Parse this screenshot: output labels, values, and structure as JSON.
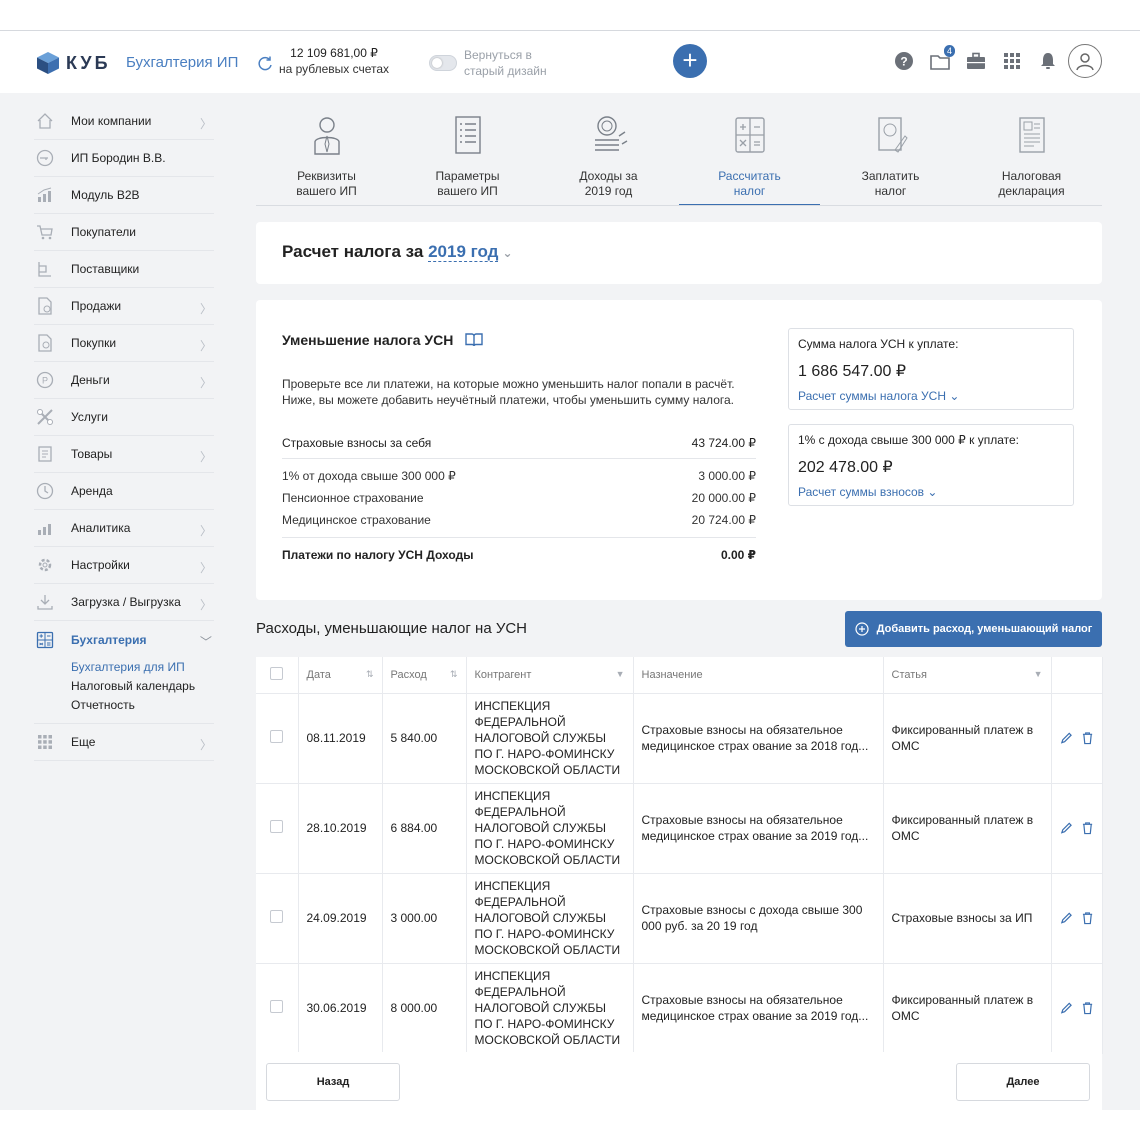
{
  "header": {
    "logo_text": "КУБ",
    "product": "Бухгалтерия ИП",
    "balance_amount": "12 109 681,00 ₽",
    "balance_caption": "на рублевых счетах",
    "toggle_label": "Вернуться в старый дизайн",
    "notifications_count": "4",
    "accent_color": "#3b6fb0"
  },
  "sidebar": {
    "items": [
      {
        "label": "Мои компании",
        "icon": "home-icon"
      },
      {
        "label": "ИП Бородин В.В.",
        "icon": "key-icon"
      },
      {
        "label": "Модуль B2B",
        "icon": "chart-icon"
      },
      {
        "label": "Покупатели",
        "icon": "cart-icon"
      },
      {
        "label": "Поставщики",
        "icon": "supplier-icon"
      },
      {
        "label": "Продажи",
        "icon": "sales-icon"
      },
      {
        "label": "Покупки",
        "icon": "purchases-icon"
      },
      {
        "label": "Деньги",
        "icon": "money-icon"
      },
      {
        "label": "Услуги",
        "icon": "services-icon"
      },
      {
        "label": "Товары",
        "icon": "goods-icon"
      },
      {
        "label": "Аренда",
        "icon": "rent-icon"
      },
      {
        "label": "Аналитика",
        "icon": "analytics-icon"
      },
      {
        "label": "Настройки",
        "icon": "settings-icon"
      },
      {
        "label": "Загрузка / Выгрузка",
        "icon": "upload-icon"
      },
      {
        "label": "Бухгалтерия",
        "icon": "accounting-icon"
      }
    ],
    "sub_items": [
      "Бухгалтерия для ИП",
      "Налоговый календарь",
      "Отчетность"
    ],
    "more_label": "Еще"
  },
  "steps": [
    {
      "label1": "Реквизиты",
      "label2": "вашего ИП"
    },
    {
      "label1": "Параметры",
      "label2": "вашего ИП"
    },
    {
      "label1": "Доходы за",
      "label2": "2019 год"
    },
    {
      "label1": "Рассчитать",
      "label2": "налог"
    },
    {
      "label1": "Заплатить",
      "label2": "налог"
    },
    {
      "label1": "Налоговая",
      "label2": "декларация"
    }
  ],
  "year_card": {
    "title": "Расчет налога за",
    "year": "2019 год"
  },
  "tax": {
    "title": "Уменьшение налога УСН",
    "desc1": "Проверьте все ли платежи, на которые можно уменьшить налог попали в расчёт.",
    "desc2": "Ниже, вы можете добавить неучётный платежи, чтобы уменьшить сумму налога.",
    "insurance_label": "Страховые взносы за себя",
    "insurance_value": "43 724.00 ₽",
    "sub_rows": [
      {
        "label": "1% от дохода свыше 300 000 ₽",
        "value": "3 000.00 ₽"
      },
      {
        "label": "Пенсионное страхование",
        "value": "20 000.00 ₽"
      },
      {
        "label": "Медицинское страхование",
        "value": "20 724.00 ₽"
      }
    ],
    "usn_label": "Платежи по налогу УСН Доходы",
    "usn_value": "0.00 ₽",
    "box1_label": "Сумма налога УСН к уплате:",
    "box1_value": "1 686 547.00 ₽",
    "box1_link": "Расчет суммы налога УСН",
    "box2_label": "1% с дохода свыше 300 000 ₽ к уплате:",
    "box2_value": "202 478.00 ₽",
    "box2_link": "Расчет суммы взносов"
  },
  "expenses": {
    "title": "Расходы, уменьшающие налог на УСН",
    "add_label": "Добавить расход, уменьшающий налог",
    "columns": [
      "Дата",
      "Расход",
      "Контрагент",
      "Назначение",
      "Статья"
    ],
    "rows": [
      {
        "date": "08.11.2019",
        "amount": "5 840.00",
        "contractor": "ИНСПЕКЦИЯ ФЕДЕРАЛЬНОЙ НАЛОГОВОЙ СЛУЖБЫ ПО Г. НАРО-ФОМИНСКУ МОСКОВСКОЙ ОБЛАСТИ",
        "purpose": "Страховые взносы на обязательное медицинское страх ование за 2018 год...",
        "article": "Фиксированный платеж в ОМС"
      },
      {
        "date": "28.10.2019",
        "amount": "6 884.00",
        "contractor": "ИНСПЕКЦИЯ ФЕДЕРАЛЬНОЙ НАЛОГОВОЙ СЛУЖБЫ ПО Г. НАРО-ФОМИНСКУ МОСКОВСКОЙ ОБЛАСТИ",
        "purpose": "Страховые взносы на обязательное медицинское страх ование за 2019 год...",
        "article": "Фиксированный платеж в ОМС"
      },
      {
        "date": "24.09.2019",
        "amount": "3 000.00",
        "contractor": "ИНСПЕКЦИЯ ФЕДЕРАЛЬНОЙ НАЛОГОВОЙ СЛУЖБЫ ПО Г. НАРО-ФОМИНСКУ МОСКОВСКОЙ ОБЛАСТИ",
        "purpose": "Страховые взносы с дохода свыше 300 000 руб. за 20 19 год",
        "article": "Страховые взносы за ИП"
      },
      {
        "date": "30.06.2019",
        "amount": "8 000.00",
        "contractor": "ИНСПЕКЦИЯ ФЕДЕРАЛЬНОЙ НАЛОГОВОЙ СЛУЖБЫ ПО Г. НАРО-ФОМИНСКУ МОСКОВСКОЙ ОБЛАСТИ",
        "purpose": "Страховые взносы на обязательное медицинское страх ование за 2019 год...",
        "article": "Фиксированный платеж в ОМС"
      }
    ]
  },
  "nav": {
    "back_label": "Назад",
    "next_label": "Далее"
  }
}
